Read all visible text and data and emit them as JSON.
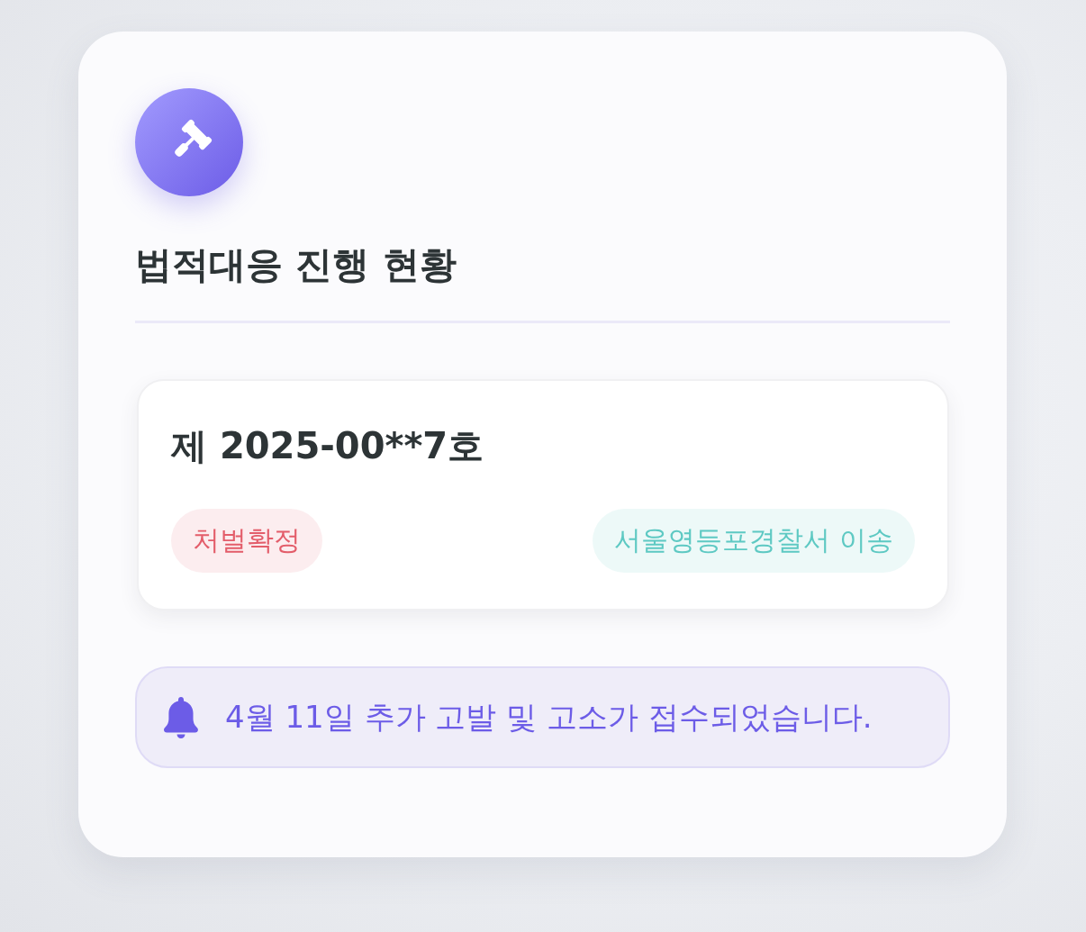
{
  "header": {
    "title": "법적대응 진행 현황"
  },
  "case": {
    "number": "제 2025-00**7호",
    "tags": [
      {
        "label": "처벌확정",
        "color": "#e35d6a"
      },
      {
        "label": "서울영등포경찰서 이송",
        "color": "#5ec9c3"
      }
    ]
  },
  "notice": {
    "text": "4월 11일 추가 고발 및 고소가 접수되었습니다."
  }
}
